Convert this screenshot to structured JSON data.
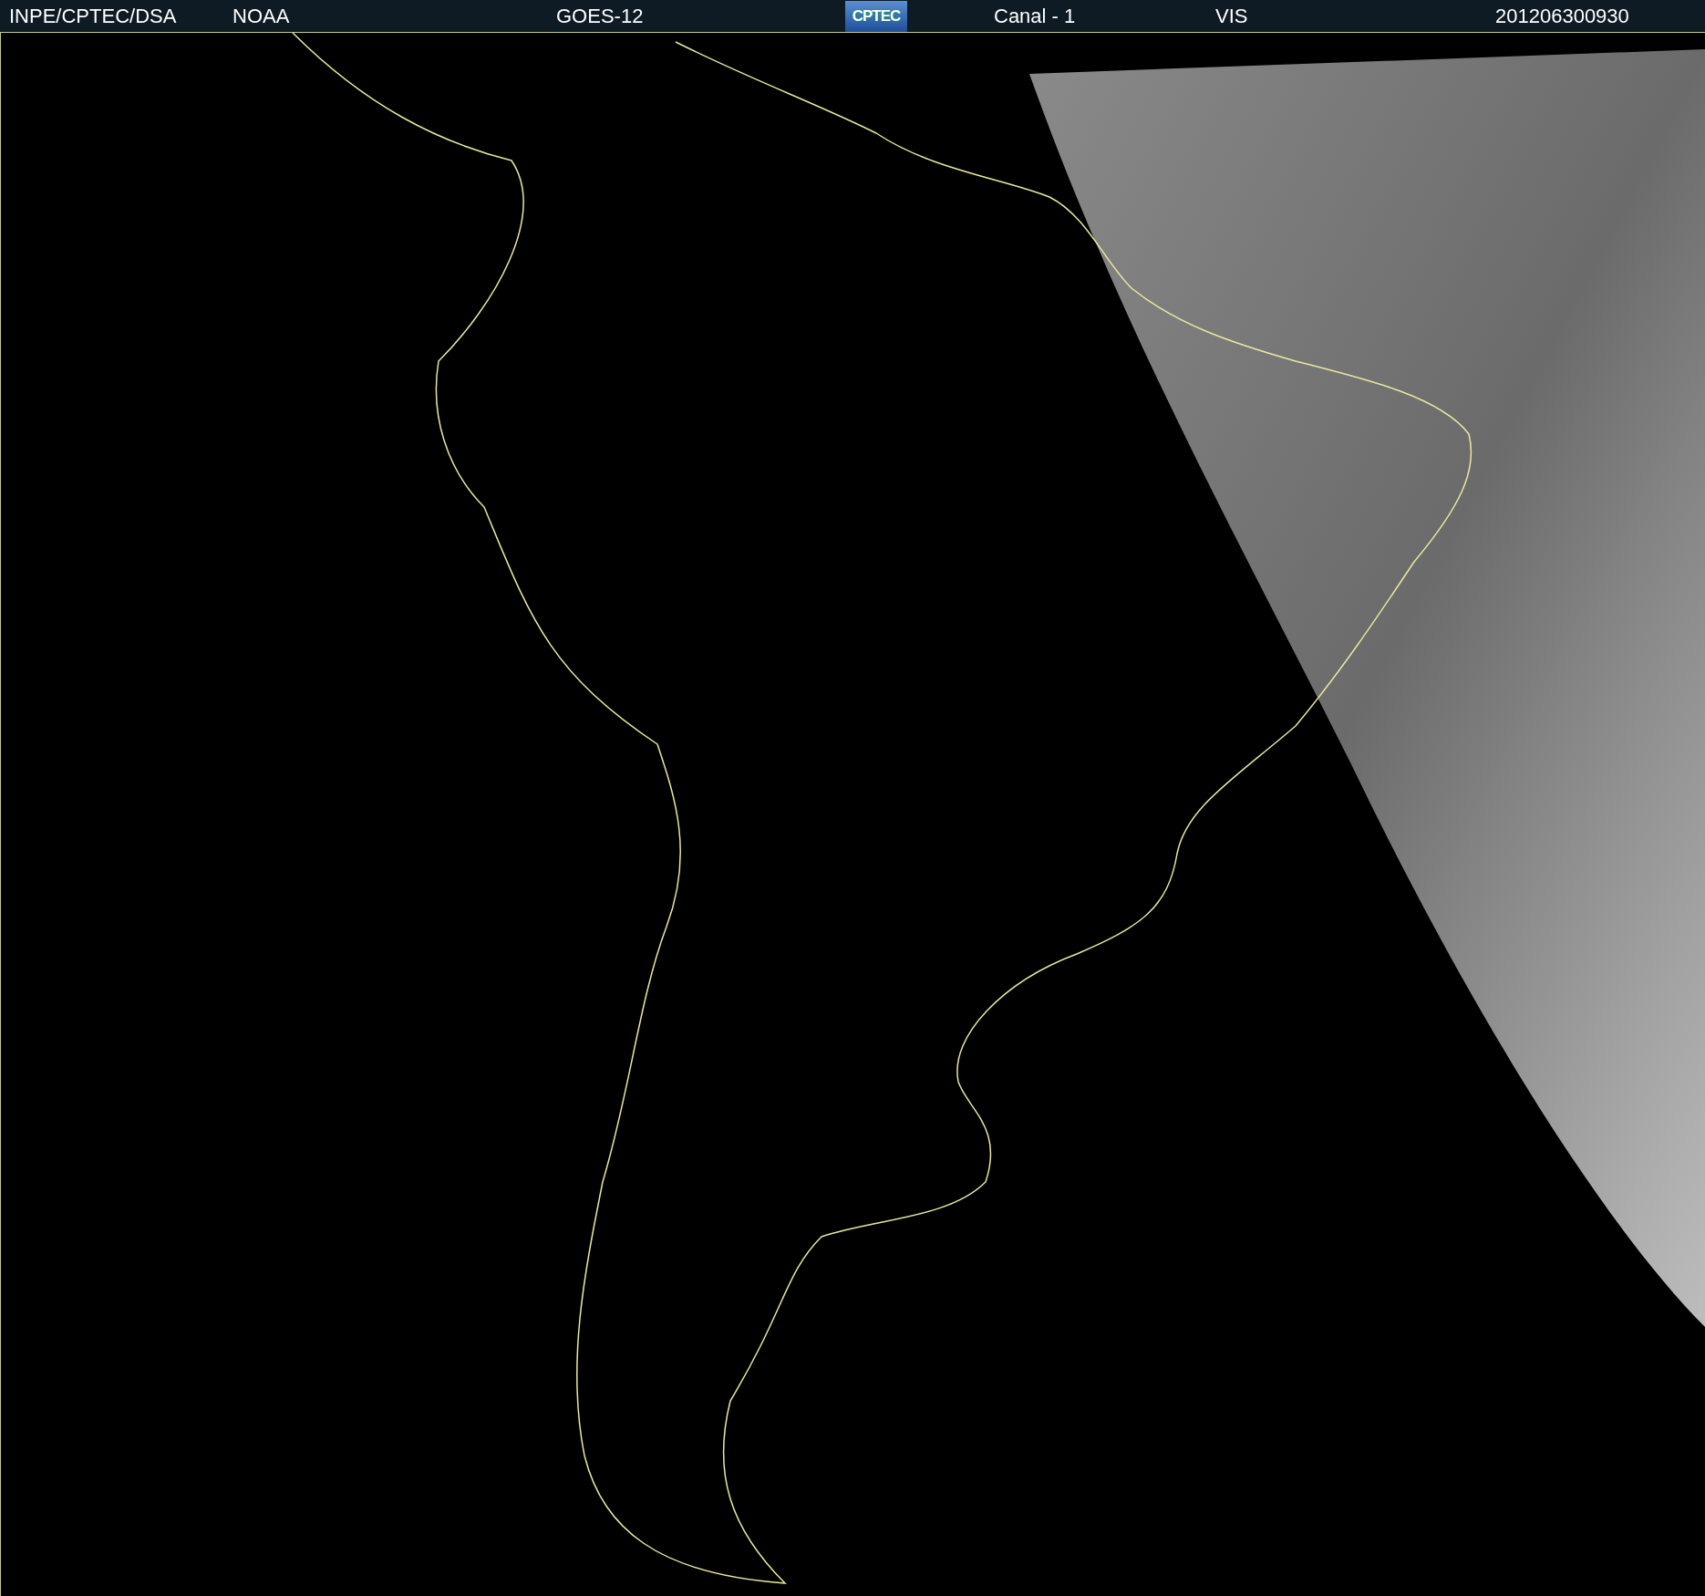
{
  "header": {
    "source": "INPE/CPTEC/DSA",
    "agency": "NOAA",
    "satellite": "GOES-12",
    "logo": "CPTEC",
    "channel": "Canal - 1",
    "band": "VIS",
    "timestamp": "201206300930"
  }
}
